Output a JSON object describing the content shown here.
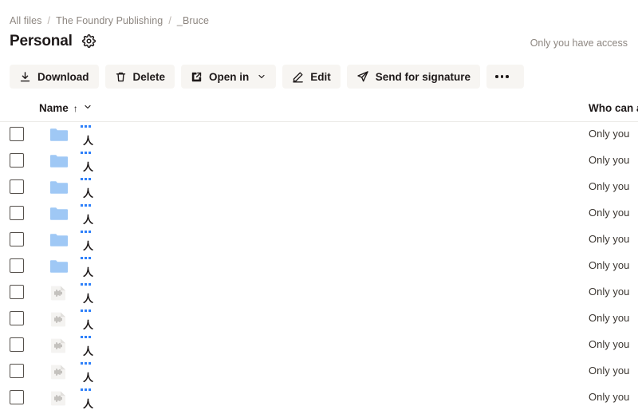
{
  "breadcrumb": {
    "separator": "/",
    "items": [
      "All files",
      "The Foundry Publishing",
      "_Bruce"
    ]
  },
  "header": {
    "title": "Personal",
    "settings_icon": "gear-icon",
    "access_note": "Only you have access"
  },
  "toolbar": {
    "buttons": [
      {
        "label": "Download",
        "icon": "download-icon",
        "caret": false
      },
      {
        "label": "Delete",
        "icon": "trash-icon",
        "caret": false
      },
      {
        "label": "Open in",
        "icon": "external-link-icon",
        "caret": true
      },
      {
        "label": "Edit",
        "icon": "pencil-icon",
        "caret": false
      },
      {
        "label": "Send for signature",
        "icon": "paper-plane-icon",
        "caret": false
      }
    ],
    "overflow_label": "",
    "overflow_icon": "ellipsis-icon"
  },
  "table": {
    "columns": [
      {
        "label": "Name",
        "sort": "↑",
        "chevron": "chevron-down-icon"
      },
      {
        "label": "Who can ac"
      }
    ],
    "rows": [
      {
        "icon": "folder-icon",
        "name": "",
        "glyph": "人",
        "access": "Only you"
      },
      {
        "icon": "folder-icon",
        "name": "",
        "glyph": "人",
        "access": "Only you"
      },
      {
        "icon": "folder-icon",
        "name": "",
        "glyph": "人",
        "access": "Only you"
      },
      {
        "icon": "folder-icon",
        "name": "",
        "glyph": "人",
        "access": "Only you"
      },
      {
        "icon": "folder-icon",
        "name": "",
        "glyph": "人",
        "access": "Only you"
      },
      {
        "icon": "folder-icon",
        "name": "",
        "glyph": "人",
        "access": "Only you"
      },
      {
        "icon": "audio-file-icon",
        "name": "",
        "glyph": "人",
        "access": "Only you"
      },
      {
        "icon": "audio-file-icon",
        "name": "",
        "glyph": "人",
        "access": "Only you"
      },
      {
        "icon": "audio-file-icon",
        "name": "",
        "glyph": "人",
        "access": "Only you"
      },
      {
        "icon": "audio-file-icon",
        "name": "",
        "glyph": "人",
        "access": "Only you"
      },
      {
        "icon": "audio-file-icon",
        "name": "",
        "glyph": "人",
        "access": "Only you"
      }
    ]
  },
  "colors": {
    "background": "#ffffff",
    "button_bg": "#f7f5f2",
    "text": "#1e1919",
    "muted_text": "#8d8680",
    "folder_blue": "#9fc8f5",
    "accent_blue": "#2d7ff9",
    "divider": "#eceae7"
  }
}
